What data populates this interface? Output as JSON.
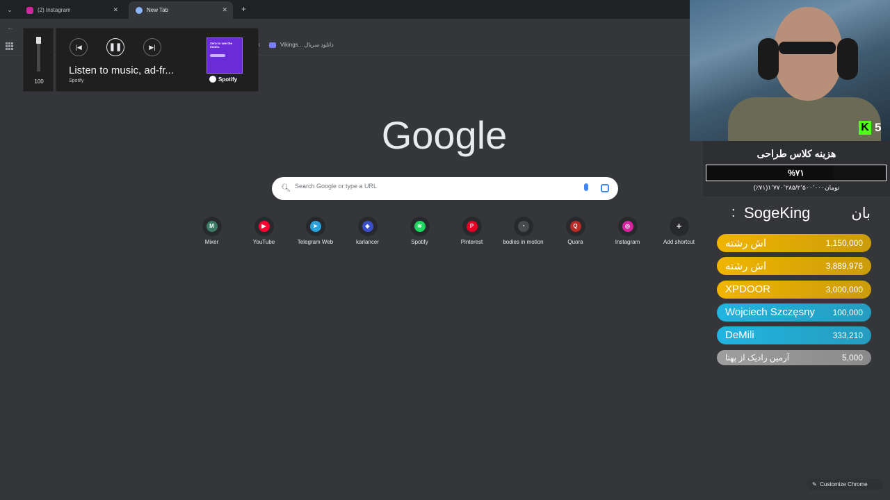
{
  "tabs": [
    {
      "title": "(2) Instagram",
      "active": false
    },
    {
      "title": "New Tab",
      "active": true
    }
  ],
  "bookmarks": {
    "k_label": "k",
    "item": "Vikings... دانلود سریال"
  },
  "media": {
    "volume": "100",
    "volume_level": 1.0,
    "title": "Listen to music, ad-fr...",
    "source": "Spotify",
    "thumb_text": "Zero to see the music.",
    "logo_text": "Spotify"
  },
  "google": {
    "logo": "Google",
    "search_placeholder": "Search Google or type a URL",
    "shortcuts": [
      {
        "label": "Mixer",
        "icon": "M",
        "color": "#3d7a66"
      },
      {
        "label": "YouTube",
        "icon": "▶",
        "color": "#ff0033"
      },
      {
        "label": "Telegram Web",
        "icon": "➤",
        "color": "#2aa1da"
      },
      {
        "label": "karlancer",
        "icon": "◈",
        "color": "#3a4fc9"
      },
      {
        "label": "Spotify",
        "icon": "≋",
        "color": "#1ed760"
      },
      {
        "label": "Pinterest",
        "icon": "P",
        "color": "#e60023"
      },
      {
        "label": "bodies in motion",
        "icon": "◔",
        "color": "#4a4b4f"
      },
      {
        "label": "Quora",
        "icon": "Q",
        "color": "#b92b27"
      },
      {
        "label": "Instagram",
        "icon": "◎",
        "color": "#d6249f"
      },
      {
        "label": "Add shortcut",
        "icon": "+",
        "color": "#28292c"
      }
    ],
    "customize_label": "Customize Chrome"
  },
  "stream": {
    "kick_logo": "K",
    "kick_count": "5",
    "goal_title": "هزینه کلاس طراحی",
    "goal_percent": "%۷۱",
    "goal_fraction": 0.71,
    "goal_amount": "(٪۷۱)۱٬۷۷۰٬۲۸۵/۲٬۵۰۰٬۰۰۰تومان",
    "top_label": "بان",
    "top_colon": ":",
    "top_name": "SogeKing",
    "donors": [
      {
        "name": "اش رشته",
        "amount": "1,150,000",
        "color": "#f0b500"
      },
      {
        "name": "اش رشته",
        "amount": "3,889,976",
        "color": "#f0b500"
      },
      {
        "name": "XPDOOR",
        "amount": "3,000,000",
        "color": "#f0b500"
      },
      {
        "name": "Wojciech Szczęsny",
        "amount": "100,000",
        "color": "#21b5e0"
      },
      {
        "name": "DeMili",
        "amount": "333,210",
        "color": "#21b5e0"
      },
      {
        "name": "آرمین رادیک از پهنا",
        "amount": "5,000",
        "color": "#9e9e9e"
      }
    ]
  }
}
